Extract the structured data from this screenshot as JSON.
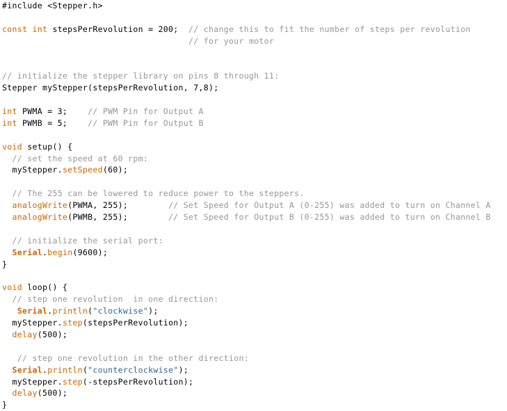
{
  "document": {
    "kind": "source-code-listing",
    "language": "Arduino C++",
    "background_color": "#ffffff",
    "colors": {
      "plain": "#000000",
      "keyword": "#cc6600",
      "function": "#cc6600",
      "library": "#cc6600",
      "method": "#cc6600",
      "comment": "#969696",
      "string": "#2a6599"
    }
  },
  "code": {
    "lines": [
      {
        "n": 1,
        "text": "#include <Stepper.h>",
        "tokens": [
          {
            "t": "#include <",
            "c": "plain"
          },
          {
            "t": "Stepper",
            "c": "library"
          },
          {
            "t": ".h>",
            "c": "plain"
          }
        ]
      },
      {
        "n": 2,
        "text": "",
        "tokens": []
      },
      {
        "n": 3,
        "text": "const int stepsPerRevolution = 200;  // change this to fit the number of steps per revolution",
        "tokens": [
          {
            "t": "const int",
            "c": "keyword"
          },
          {
            "t": " stepsPerRevolution = 200;  ",
            "c": "plain"
          },
          {
            "t": "// change this to fit the number of steps per revolution",
            "c": "comment"
          }
        ]
      },
      {
        "n": 4,
        "text": "                                     // for your motor",
        "tokens": [
          {
            "t": "                                     ",
            "c": "plain"
          },
          {
            "t": "// for your motor",
            "c": "comment"
          }
        ]
      },
      {
        "n": 5,
        "text": "",
        "tokens": []
      },
      {
        "n": 6,
        "text": "",
        "tokens": []
      },
      {
        "n": 7,
        "text": "// initialize the stepper library on pins 8 through 11:",
        "tokens": [
          {
            "t": "// initialize the stepper library on pins 8 through 11:",
            "c": "comment"
          }
        ]
      },
      {
        "n": 8,
        "text": "Stepper myStepper(stepsPerRevolution, 7,8);",
        "tokens": [
          {
            "t": "Stepper",
            "c": "library"
          },
          {
            "t": " myStepper(stepsPerRevolution, 7,8);",
            "c": "plain"
          }
        ]
      },
      {
        "n": 9,
        "text": "",
        "tokens": []
      },
      {
        "n": 10,
        "text": "int PWMA = 3;    // PWM Pin for Output A",
        "tokens": [
          {
            "t": "int",
            "c": "keyword"
          },
          {
            "t": " PWMA = 3;    ",
            "c": "plain"
          },
          {
            "t": "// PWM Pin for Output A",
            "c": "comment"
          }
        ]
      },
      {
        "n": 11,
        "text": "int PWMB = 5;    // PWM Pin for Output B",
        "tokens": [
          {
            "t": "int",
            "c": "keyword"
          },
          {
            "t": " PWMB = 5;    ",
            "c": "plain"
          },
          {
            "t": "// PWM Pin for Output B",
            "c": "comment"
          }
        ]
      },
      {
        "n": 12,
        "text": "",
        "tokens": []
      },
      {
        "n": 13,
        "text": "void setup() {",
        "tokens": [
          {
            "t": "void ",
            "c": "keyword"
          },
          {
            "t": "setup",
            "c": "function"
          },
          {
            "t": "() {",
            "c": "plain"
          }
        ]
      },
      {
        "n": 14,
        "text": "  // set the speed at 60 rpm:",
        "tokens": [
          {
            "t": "  ",
            "c": "plain"
          },
          {
            "t": "// set the speed at 60 rpm:",
            "c": "comment"
          }
        ]
      },
      {
        "n": 15,
        "text": "  myStepper.setSpeed(60);",
        "tokens": [
          {
            "t": "  myStepper.",
            "c": "plain"
          },
          {
            "t": "setSpeed",
            "c": "method"
          },
          {
            "t": "(60);",
            "c": "plain"
          }
        ]
      },
      {
        "n": 16,
        "text": "",
        "tokens": []
      },
      {
        "n": 17,
        "text": "  // The 255 can be lowered to reduce power to the steppers.",
        "tokens": [
          {
            "t": "  ",
            "c": "plain"
          },
          {
            "t": "// The 255 can be lowered to reduce power to the steppers.",
            "c": "comment"
          }
        ]
      },
      {
        "n": 18,
        "text": "  analogWrite(PWMA, 255);        // Set Speed for Output A (0-255) was added to turn on Channel A",
        "tokens": [
          {
            "t": "  ",
            "c": "plain"
          },
          {
            "t": "analogWrite",
            "c": "method"
          },
          {
            "t": "(PWMA, 255);        ",
            "c": "plain"
          },
          {
            "t": "// Set Speed for Output A (0-255) was added to turn on Channel A",
            "c": "comment"
          }
        ]
      },
      {
        "n": 19,
        "text": "  analogWrite(PWMB, 255);        // Set Speed for Output B (0-255) was added to turn on Channel B",
        "tokens": [
          {
            "t": "  ",
            "c": "plain"
          },
          {
            "t": "analogWrite",
            "c": "method"
          },
          {
            "t": "(PWMB, 255);        ",
            "c": "plain"
          },
          {
            "t": "// Set Speed for Output B (0-255) was added to turn on Channel B",
            "c": "comment"
          }
        ]
      },
      {
        "n": 20,
        "text": "",
        "tokens": []
      },
      {
        "n": 21,
        "text": "  // initialize the serial port:",
        "tokens": [
          {
            "t": "  ",
            "c": "plain"
          },
          {
            "t": "// initialize the serial port:",
            "c": "comment"
          }
        ]
      },
      {
        "n": 22,
        "text": "  Serial.begin(9600);",
        "tokens": [
          {
            "t": "  ",
            "c": "plain"
          },
          {
            "t": "Serial",
            "c": "libbold"
          },
          {
            "t": ".",
            "c": "plain"
          },
          {
            "t": "begin",
            "c": "method"
          },
          {
            "t": "(9600);",
            "c": "plain"
          }
        ]
      },
      {
        "n": 23,
        "text": "}",
        "tokens": [
          {
            "t": "}",
            "c": "plain"
          }
        ]
      },
      {
        "n": 24,
        "text": "",
        "tokens": []
      },
      {
        "n": 25,
        "text": "void loop() {",
        "tokens": [
          {
            "t": "void ",
            "c": "keyword"
          },
          {
            "t": "loop",
            "c": "function"
          },
          {
            "t": "() {",
            "c": "plain"
          }
        ]
      },
      {
        "n": 26,
        "text": "  // step one revolution  in one direction:",
        "tokens": [
          {
            "t": "  ",
            "c": "plain"
          },
          {
            "t": "// step one revolution  in one direction:",
            "c": "comment"
          }
        ]
      },
      {
        "n": 27,
        "text": "   Serial.println(\"clockwise\");",
        "tokens": [
          {
            "t": "   ",
            "c": "plain"
          },
          {
            "t": "Serial",
            "c": "libbold"
          },
          {
            "t": ".",
            "c": "plain"
          },
          {
            "t": "println",
            "c": "method"
          },
          {
            "t": "(",
            "c": "plain"
          },
          {
            "t": "\"clockwise\"",
            "c": "string"
          },
          {
            "t": ");",
            "c": "plain"
          }
        ]
      },
      {
        "n": 28,
        "text": "  myStepper.step(stepsPerRevolution);",
        "tokens": [
          {
            "t": "  myStepper.",
            "c": "plain"
          },
          {
            "t": "step",
            "c": "method"
          },
          {
            "t": "(stepsPerRevolution);",
            "c": "plain"
          }
        ]
      },
      {
        "n": 29,
        "text": "  delay(500);",
        "tokens": [
          {
            "t": "  ",
            "c": "plain"
          },
          {
            "t": "delay",
            "c": "method"
          },
          {
            "t": "(500);",
            "c": "plain"
          }
        ]
      },
      {
        "n": 30,
        "text": "",
        "tokens": []
      },
      {
        "n": 31,
        "text": "   // step one revolution in the other direction:",
        "tokens": [
          {
            "t": "   ",
            "c": "plain"
          },
          {
            "t": "// step one revolution in the other direction:",
            "c": "comment"
          }
        ]
      },
      {
        "n": 32,
        "text": "  Serial.println(\"counterclockwise\");",
        "tokens": [
          {
            "t": "  ",
            "c": "plain"
          },
          {
            "t": "Serial",
            "c": "libbold"
          },
          {
            "t": ".",
            "c": "plain"
          },
          {
            "t": "println",
            "c": "method"
          },
          {
            "t": "(",
            "c": "plain"
          },
          {
            "t": "\"counterclockwise\"",
            "c": "string"
          },
          {
            "t": ");",
            "c": "plain"
          }
        ]
      },
      {
        "n": 33,
        "text": "  myStepper.step(-stepsPerRevolution);",
        "tokens": [
          {
            "t": "  myStepper.",
            "c": "plain"
          },
          {
            "t": "step",
            "c": "method"
          },
          {
            "t": "(-stepsPerRevolution);",
            "c": "plain"
          }
        ]
      },
      {
        "n": 34,
        "text": "  delay(500);",
        "tokens": [
          {
            "t": "  ",
            "c": "plain"
          },
          {
            "t": "delay",
            "c": "method"
          },
          {
            "t": "(500);",
            "c": "plain"
          }
        ]
      },
      {
        "n": 35,
        "text": "}",
        "tokens": [
          {
            "t": "}",
            "c": "plain"
          }
        ]
      }
    ]
  }
}
